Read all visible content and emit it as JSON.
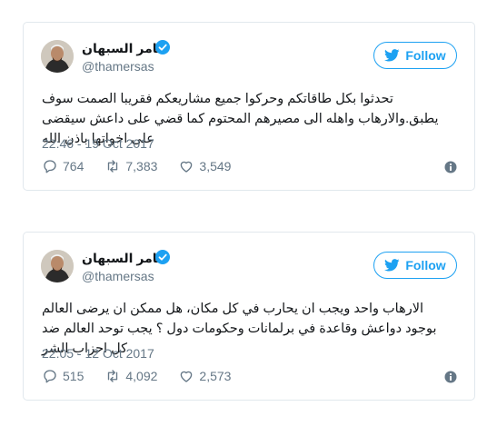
{
  "colors": {
    "accent": "#1da1f2",
    "muted": "#657786",
    "text": "#14171a",
    "border": "#e1e8ed"
  },
  "tweets": [
    {
      "user": {
        "name": "ثامر السبهان",
        "handle": "@thamersas",
        "verified": true,
        "avatar": "avatar-photo"
      },
      "follow_label": "Follow",
      "text": "تحدثوا بكل طاقاتكم وحركوا جميع مشاريعكم فقريبا الصمت سوف يطبق.والارهاب واهله الى مصيرهم المحتوم كما قضي على داعش سيقضى على اخواتها باذن الله",
      "timestamp": "22:46 - 19 Oct 2017",
      "stats": {
        "replies": "764",
        "retweets": "7,383",
        "likes": "3,549"
      },
      "icons": [
        "reply-icon",
        "retweet-icon",
        "like-icon",
        "info-icon"
      ]
    },
    {
      "user": {
        "name": "ثامر السبهان",
        "handle": "@thamersas",
        "verified": true,
        "avatar": "avatar-photo"
      },
      "follow_label": "Follow",
      "text": "الارهاب واحد ويجب ان يحارب في كل مكان، هل ممكن ان يرضى العالم بوجود دواعش وقاعدة في برلمانات وحكومات دول ؟ يجب توحد العالم ضد كل احزاب الشر",
      "timestamp": "22:05 - 12 Oct 2017",
      "stats": {
        "replies": "515",
        "retweets": "4,092",
        "likes": "2,573"
      },
      "icons": [
        "reply-icon",
        "retweet-icon",
        "like-icon",
        "info-icon"
      ]
    }
  ]
}
